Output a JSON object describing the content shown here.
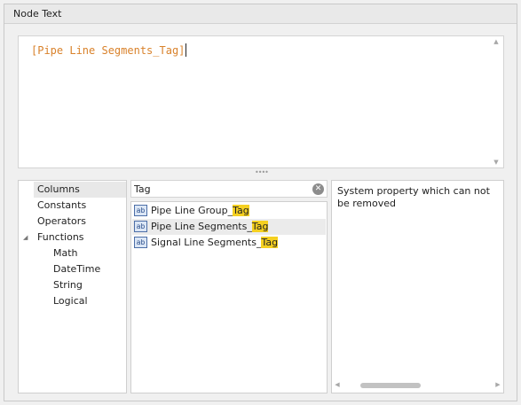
{
  "group": {
    "title": "Node Text"
  },
  "editor": {
    "expression": "[Pipe Line Segments_Tag]"
  },
  "tree": {
    "items": [
      {
        "label": "Columns"
      },
      {
        "label": "Constants"
      },
      {
        "label": "Operators"
      },
      {
        "label": "Functions"
      },
      {
        "label": "Math"
      },
      {
        "label": "DateTime"
      },
      {
        "label": "String"
      },
      {
        "label": "Logical"
      }
    ],
    "selected": "Columns"
  },
  "search": {
    "value": "Tag"
  },
  "columns_list": {
    "items": [
      {
        "prefix": "Pipe Line Group_",
        "match": "Tag",
        "icon": "ab-field-icon"
      },
      {
        "prefix": "Pipe Line Segments_",
        "match": "Tag",
        "icon": "ab-field-icon"
      },
      {
        "prefix": "Signal Line Segments_",
        "match": "Tag",
        "icon": "ab-field-icon"
      }
    ],
    "selected": "Pipe Line Segments_Tag"
  },
  "description": {
    "text": "System property which can not be removed"
  },
  "colors": {
    "expression": "#d9822b",
    "highlight": "#f5d020",
    "selection": "#e8e8e8"
  }
}
